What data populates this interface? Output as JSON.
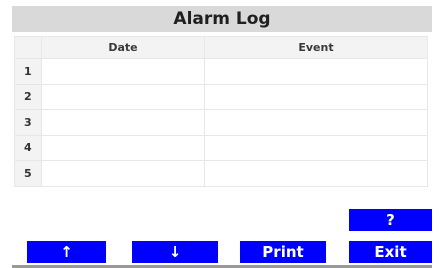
{
  "title": "Alarm Log",
  "table": {
    "columns": [
      "Date",
      "Event"
    ],
    "rows": [
      {
        "index": "1",
        "date": "",
        "event": ""
      },
      {
        "index": "2",
        "date": "",
        "event": ""
      },
      {
        "index": "3",
        "date": "",
        "event": ""
      },
      {
        "index": "4",
        "date": "",
        "event": ""
      },
      {
        "index": "5",
        "date": "",
        "event": ""
      }
    ]
  },
  "buttons": {
    "help": "?",
    "up": "↑",
    "down": "↓",
    "print": "Print",
    "exit": "Exit"
  },
  "colors": {
    "button_bg": "#0000ff",
    "title_bg": "#d9d9d9"
  }
}
